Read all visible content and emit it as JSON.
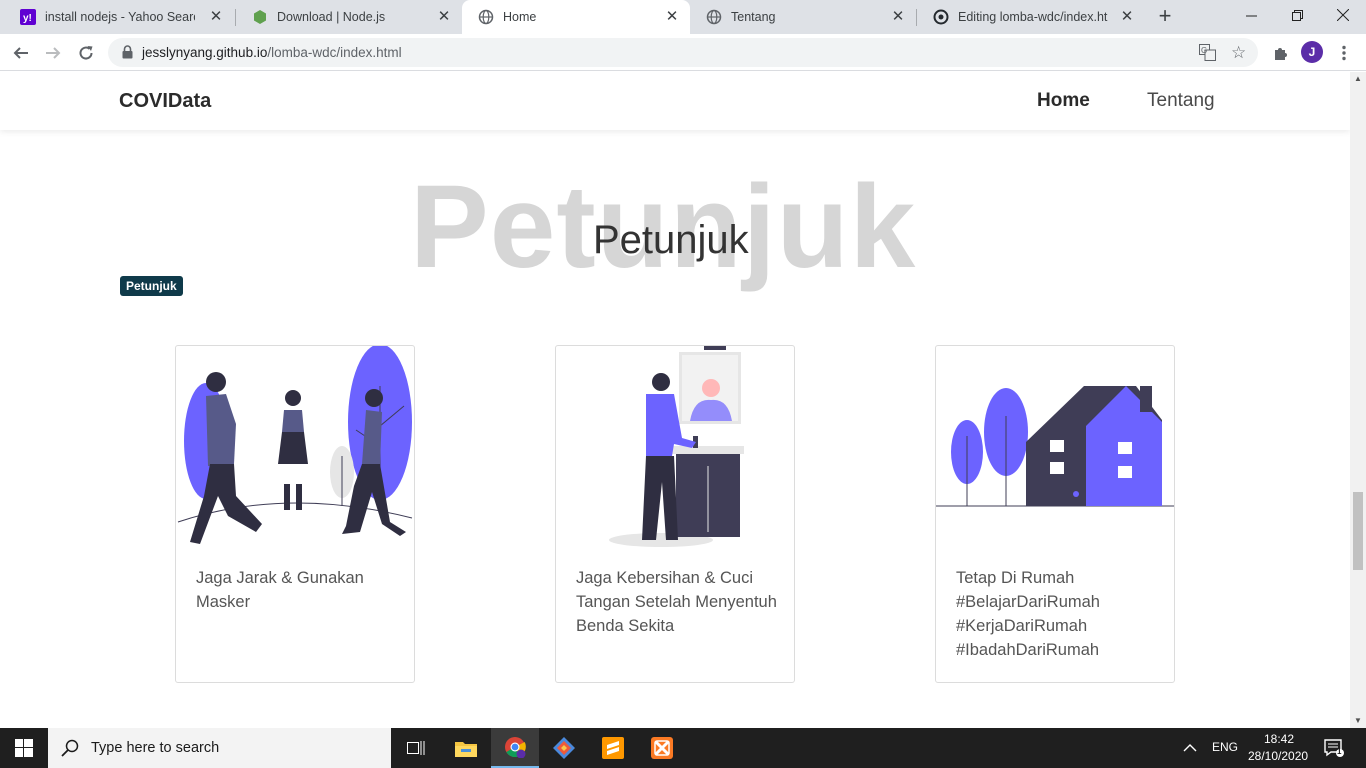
{
  "browser": {
    "tabs": [
      {
        "title": "install nodejs - Yahoo Search R",
        "icon": "yahoo-icon",
        "active": false
      },
      {
        "title": "Download | Node.js",
        "icon": "nodejs-icon",
        "active": false
      },
      {
        "title": "Home",
        "icon": "globe-icon",
        "active": true
      },
      {
        "title": "Tentang",
        "icon": "globe-icon",
        "active": false
      },
      {
        "title": "Editing lomba-wdc/index.html",
        "icon": "github-icon",
        "active": false
      }
    ],
    "url_host": "jesslynyang.github.io",
    "url_path": "/lomba-wdc/index.html",
    "profile_initial": "J"
  },
  "page": {
    "brand": "COVIData",
    "nav": [
      {
        "label": "Home",
        "active": true
      },
      {
        "label": "Tentang",
        "active": false
      }
    ],
    "section_bg_title": "Petunjuk",
    "section_title": "Petunjuk",
    "badge": "Petunjuk",
    "cards": [
      {
        "text": "Jaga Jarak & Gunakan Masker",
        "illustration": "social-distancing-illustration"
      },
      {
        "text": "Jaga Kebersihan & Cuci Tangan Setelah Menyentuh Benda Sekita",
        "illustration": "handwashing-illustration"
      },
      {
        "text": "Tetap Di Rumah #BelajarDariRumah #KerjaDariRumah #IbadahDariRumah",
        "illustration": "stay-home-illustration"
      }
    ]
  },
  "taskbar": {
    "search_placeholder": "Type here to search",
    "language": "ENG",
    "time": "18:42",
    "date": "28/10/2020",
    "notification_count": "1"
  },
  "colors": {
    "accent_purple": "#6c63ff",
    "dark_navy": "#3f3d56",
    "badge_bg": "#0f3a4a"
  }
}
